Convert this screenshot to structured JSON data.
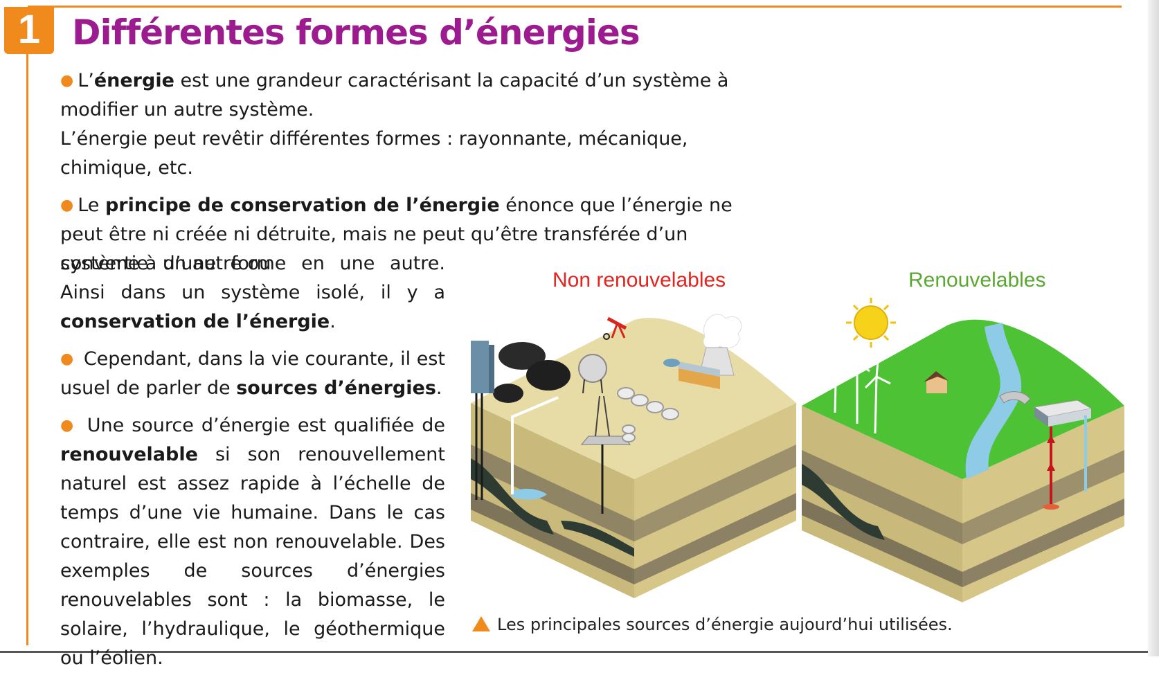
{
  "section": {
    "number": "1",
    "title": "Différentes formes d’énergies"
  },
  "paragraphs": {
    "p1_pre": "L’",
    "p1_bold": "énergie",
    "p1_post": " est une grandeur caractérisant la capacité d’un système à modifier un autre système.",
    "p1b": "L’énergie peut revêtir différentes formes : rayonnante, mécanique, chimique, etc.",
    "p2_pre": "Le ",
    "p2_bold": "principe de conservation de l’énergie",
    "p2_post": " énonce que l’énergie ne peut être ni créée ni détruite, mais ne peut qu’être transférée d’un système à un autre ou",
    "p2b_pre": "convertie d’une forme en une autre. Ainsi dans un système isolé, il y a ",
    "p2b_bold": "conservation de l’énergie",
    "p2b_post": ".",
    "p3_pre": " Cependant, dans la vie courante, il est usuel de parler de ",
    "p3_bold": "sources d’énergies",
    "p3_post": ".",
    "p4_pre": " Une source d’énergie est qualifiée de ",
    "p4_bold": "renouvelable",
    "p4_post": " si son renouvellement naturel est assez rapide à l’échelle de temps d’une vie humaine. Dans le cas contraire, elle est non renouvelable. Des exemples de sources d’énergies renouvelables sont : la biomasse, le solaire, l’hydraulique, le géothermique ou l’éolien."
  },
  "figure": {
    "label_nonrenewable": "Non renouvelables",
    "label_renewable": "Renouvelables",
    "caption": "Les principales sources d’énergie aujourd’hui utilisées.",
    "colors": {
      "orange": "#f08a1c",
      "purple": "#9c1c8f",
      "red": "#e3241f",
      "green": "#5aa832"
    },
    "icons": [
      "coal-heap-icon",
      "oil-pump-icon",
      "nuclear-plant-icon",
      "gas-tanks-icon",
      "sun-icon",
      "wind-turbine-icon",
      "dam-icon",
      "geothermal-plant-icon",
      "house-icon"
    ]
  }
}
